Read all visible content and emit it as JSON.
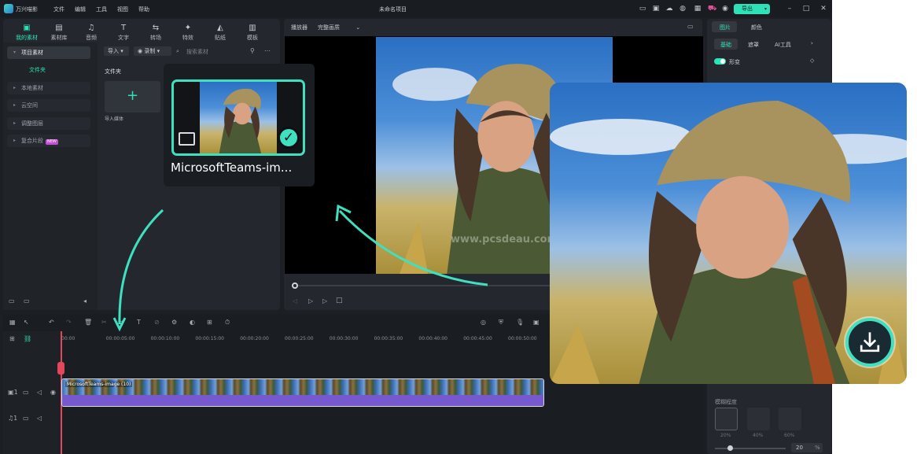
{
  "app": {
    "name": "万兴喵影",
    "project_title": "未命名项目",
    "menu": [
      "文件",
      "编辑",
      "工具",
      "视图",
      "帮助"
    ],
    "export_label": "导出"
  },
  "toolbar": [
    "我的素材",
    "素材库",
    "音频",
    "文字",
    "转场",
    "特效",
    "贴纸",
    "模板"
  ],
  "sidebar": {
    "project_media": "项目素材",
    "folder": "文件夹",
    "items": [
      "本地素材",
      "云空间",
      "调整图层",
      "复合片段"
    ],
    "new_badge": "NEW"
  },
  "media": {
    "import_label": "导入",
    "record_label": "录制",
    "search_placeholder": "搜索素材",
    "folder_heading": "文件夹",
    "import_media": "导入媒体",
    "file_name": "MicrosoftTeams-im..."
  },
  "player": {
    "label": "播放器",
    "quality": "完整画质"
  },
  "timeline": {
    "ticks": [
      "00:00",
      "00:00:05:00",
      "00:00:10:00",
      "00:00:15:00",
      "00:00:20:00",
      "00:00:25:00",
      "00:00:30:00",
      "00:00:35:00",
      "00:00:40:00",
      "00:00:45:00",
      "00:00:50:00",
      "00:0"
    ],
    "clip_name": "MicrosoftTeams-image (10)",
    "video_track": "1",
    "audio_track": "1"
  },
  "right_panel": {
    "tab_image": "图片",
    "tab_color": "颜色",
    "subtab_basic": "基础",
    "subtab_mask": "遮罩",
    "subtab_ai": "AI工具",
    "transform": "形变",
    "blur_strength": "模糊程度",
    "presets": [
      "20%",
      "40%",
      "60%"
    ],
    "value": "20",
    "unit": "%"
  },
  "watermark": "www.pcsdeau.com",
  "colors": {
    "accent": "#2ee2b7",
    "clip": "#7658cf",
    "bg": "#1c1f24"
  }
}
